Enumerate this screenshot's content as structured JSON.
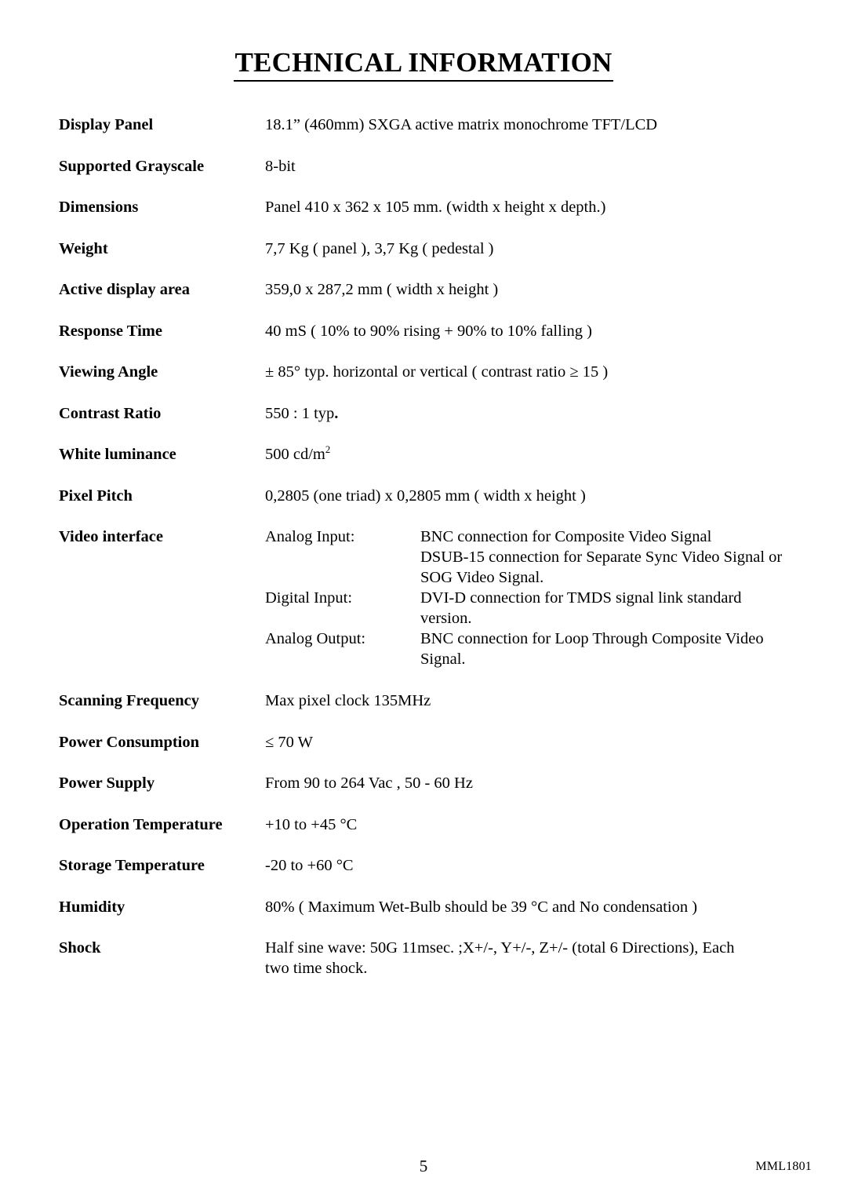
{
  "document": {
    "title": "TECHNICAL INFORMATION",
    "page_number": "5",
    "doc_code": "MML1801"
  },
  "specs": [
    {
      "label": "Display Panel",
      "value": "18.1” (460mm) SXGA active matrix monochrome TFT/LCD"
    },
    {
      "label": "Supported Grayscale",
      "value": "8-bit"
    },
    {
      "label": "Dimensions",
      "value": "Panel 410 x 362 x 105 mm. (width x height x depth.)"
    },
    {
      "label": "Weight",
      "value": "7,7 Kg ( panel ), 3,7 Kg ( pedestal )"
    },
    {
      "label": "Active display area",
      "value": "359,0 x 287,2 mm ( width x height )"
    },
    {
      "label": "Response Time",
      "value": "40 mS ( 10% to 90% rising + 90% to 10% falling )"
    },
    {
      "label": "Viewing Angle",
      "value": "± 85° typ. horizontal or vertical ( contrast ratio ≥ 15 )"
    },
    {
      "label": "Contrast Ratio",
      "value_main": "550 : 1 typ",
      "value_bold_suffix": "."
    },
    {
      "label": "White luminance",
      "value_main": "500 cd/m",
      "value_sup": "2"
    },
    {
      "label": "Pixel Pitch",
      "value": "0,2805 (one triad) x 0,2805 mm ( width x height )"
    }
  ],
  "video_interface": {
    "label": "Video interface",
    "groups": [
      {
        "sublabel": "Analog Input:",
        "lines": [
          "BNC connection for Composite Video Signal",
          "DSUB-15 connection for Separate Sync Video Signal or",
          "SOG Video Signal."
        ]
      },
      {
        "sublabel": "Digital Input:",
        "lines": [
          "DVI-D connection for TMDS signal link standard",
          "version."
        ]
      },
      {
        "sublabel": "Analog Output:",
        "lines": [
          "BNC connection for Loop Through Composite Video",
          "Signal."
        ]
      }
    ]
  },
  "specs_lower": [
    {
      "label": "Scanning Frequency",
      "value": "Max pixel clock 135MHz"
    },
    {
      "label": "Power Consumption",
      "value": "≤ 70 W"
    },
    {
      "label": "Power Supply",
      "value": "From 90 to 264 Vac , 50 - 60 Hz"
    },
    {
      "label": "Operation Temperature",
      "value": "+10 to +45 °C"
    },
    {
      "label": "Storage Temperature",
      "value": "-20 to +60 °C"
    },
    {
      "label": "Humidity",
      "value": "80% ( Maximum Wet-Bulb should be 39 °C and No condensation )"
    },
    {
      "label": "Shock",
      "value_lines": [
        "Half sine wave: 50G 11msec. ;X+/-, Y+/-, Z+/- (total 6 Directions), Each",
        "two time shock."
      ]
    }
  ]
}
